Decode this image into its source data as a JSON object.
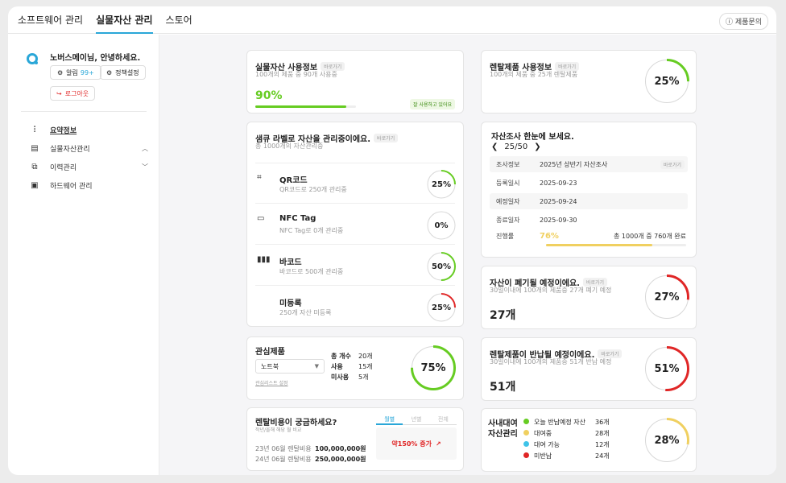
{
  "nav": {
    "tabs": [
      "소프트웨어 관리",
      "실물자산 관리",
      "스토어"
    ],
    "help": "제품문의"
  },
  "sidebar": {
    "greeting": "노버스메이님, 안녕하세요.",
    "alarm_label": "알림",
    "alarm_count": "99+",
    "policy": "정책설정",
    "logout": "로그아웃",
    "items": [
      "요약정보",
      "실물자산관리",
      "이력관리",
      "하드웨어 관리"
    ]
  },
  "colors": {
    "accent": "#2aa7d8",
    "green": "#66cc22",
    "red": "#e02626",
    "yellow": "#f0d060",
    "gray": "#cfcfcf"
  },
  "go_label": "바로가기",
  "asset_usage": {
    "title": "실물자산 사용정보",
    "sub": "100개의 제품 중 90개 사용중",
    "pct": "90%",
    "pct_value": 0.9,
    "badge": "잘 사용하고 있어요"
  },
  "rental_usage": {
    "title": "렌탈제품 사용정보",
    "sub": "100개의 제품 중 25개 렌탈제품",
    "pct": "25%",
    "pct_value": 0.25
  },
  "labels": {
    "title": "샘큐 라벨로 자산을 관리중이에요.",
    "sub": "총 1000개의 자산관리중",
    "rows": [
      {
        "name": "QR코드",
        "sub": "QR코드로 250개 관리중",
        "pct": "25%",
        "value": 0.25,
        "color": "green",
        "icon": "qr-icon",
        "glyph": "⌗"
      },
      {
        "name": "NFC Tag",
        "sub": "NFC Tag로 0개 관리중",
        "pct": "0%",
        "value": 0,
        "color": "green",
        "icon": "nfc-icon",
        "glyph": "▭"
      },
      {
        "name": "바코드",
        "sub": "바코드로 500개 관리중",
        "pct": "50%",
        "value": 0.5,
        "color": "green",
        "icon": "barcode-icon",
        "glyph": "▮▮▮"
      },
      {
        "name": "미등록",
        "sub": "250개 자산 미등록",
        "pct": "25%",
        "value": 0.25,
        "color": "red",
        "icon": "",
        "glyph": ""
      }
    ]
  },
  "survey": {
    "title": "자산조사 한눈에 보세요.",
    "page": "25/50",
    "rows": [
      {
        "k": "조사정보",
        "v": "2025년 상반기 자산조사",
        "btn": "바로가기"
      },
      {
        "k": "등록일시",
        "v": "2025-09-23"
      },
      {
        "k": "예정일자",
        "v": "2025-09-24"
      },
      {
        "k": "종료일자",
        "v": "2025-09-30"
      }
    ],
    "progress_label": "진행률",
    "progress_pct": "76%",
    "progress_value": 0.76,
    "progress_note": "총 1000개 중 760개 완료"
  },
  "disposal": {
    "title": "자산이 폐기될 예정이에요.",
    "sub": "30일이내에 100개의 제품중 27개 폐기 예정",
    "count": "27개",
    "pct": "27%",
    "value": 0.27
  },
  "interest": {
    "title": "관심제품",
    "select": "노트북",
    "link": "관심리스트 설정",
    "stats": [
      {
        "k": "총 개수",
        "v": "20개"
      },
      {
        "k": "사용",
        "v": "15개"
      },
      {
        "k": "미사용",
        "v": "5개"
      }
    ],
    "pct": "75%",
    "value": 0.75
  },
  "rental_return": {
    "title": "렌탈제품이 반납될 예정이에요.",
    "sub": "30일이내에 100개의 제품중 51개 반납 예정",
    "count": "51개",
    "pct": "51%",
    "value": 0.51
  },
  "rental_cost": {
    "title": "렌탈비용이 궁금하세요?",
    "sub": "작년/올해 해당 월 비교",
    "tabs": [
      "월별",
      "년별",
      "전체"
    ],
    "rows": [
      {
        "k": "23년 06월 렌탈비용",
        "v": "100,000,000원"
      },
      {
        "k": "24년 06월 렌탈비용",
        "v": "250,000,000원"
      }
    ],
    "increase": "약150% 증가"
  },
  "lending": {
    "title1": "사내대여",
    "title2": "자산관리",
    "items": [
      {
        "label": "오늘 반납예정 자산",
        "v": "36개",
        "color": "#66cc22"
      },
      {
        "label": "대여중",
        "v": "28개",
        "color": "#f0d060"
      },
      {
        "label": "대여 가능",
        "v": "12개",
        "color": "#3fc3e8"
      },
      {
        "label": "미반납",
        "v": "24개",
        "color": "#e02626"
      }
    ],
    "pct": "28%",
    "value": 0.28
  }
}
